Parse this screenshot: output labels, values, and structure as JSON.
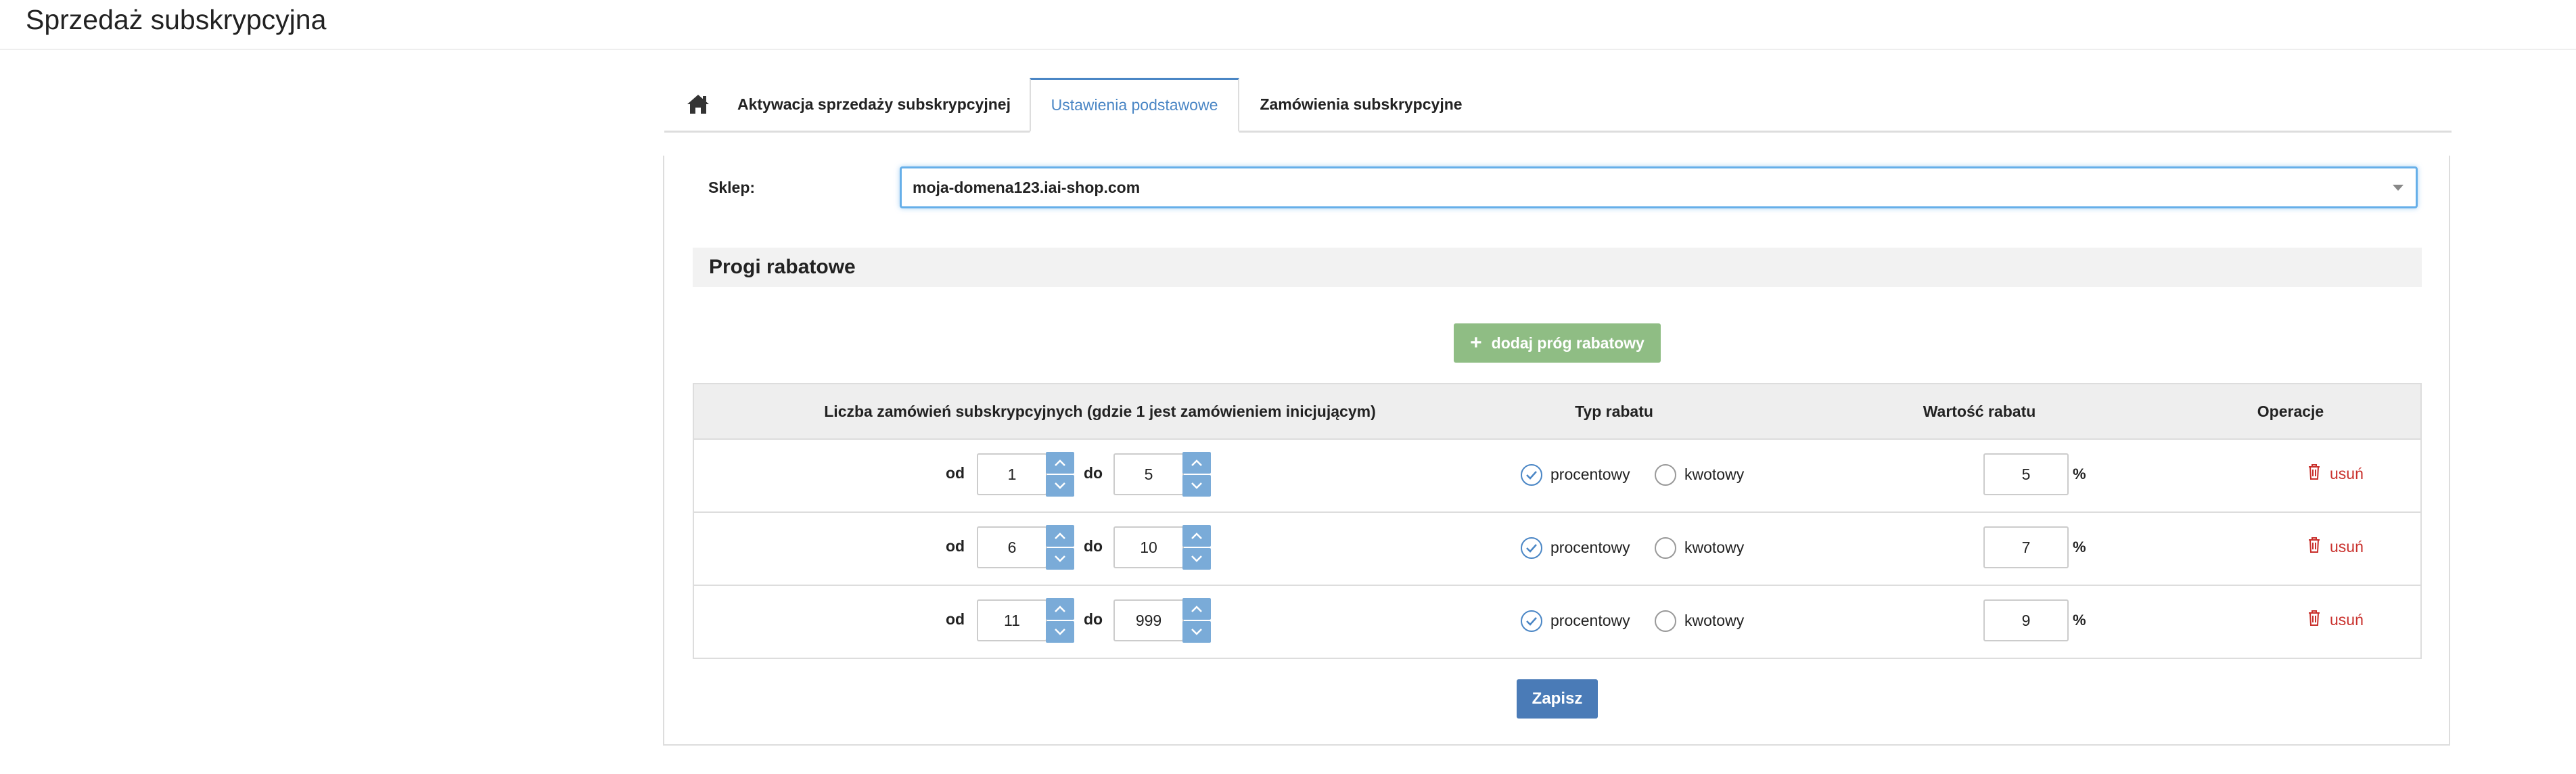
{
  "page": {
    "title": "Sprzedaż subskrypcyjna"
  },
  "tabs": {
    "home_icon": "home-icon",
    "items": [
      {
        "label": "Aktywacja sprzedaży subskrypcyjnej",
        "active": false
      },
      {
        "label": "Ustawienia podstawowe",
        "active": true
      },
      {
        "label": "Zamówienia subskrypcyjne",
        "active": false
      }
    ]
  },
  "shop": {
    "label": "Sklep:",
    "value": "moja-domena123.iai-shop.com"
  },
  "section": {
    "title": "Progi rabatowe"
  },
  "add_button": {
    "label": "dodaj próg rabatowy",
    "icon": "plus-icon"
  },
  "table": {
    "headers": [
      "Liczba zamówień subskrypcyjnych (gdzie 1 jest zamówieniem inicjującym)",
      "Typ rabatu",
      "Wartość rabatu",
      "Operacje"
    ],
    "from_label": "od",
    "to_label": "do",
    "type_percent": "procentowy",
    "type_amount": "kwotowy",
    "unit": "%",
    "delete_label": "usuń",
    "rows": [
      {
        "from": "1",
        "to": "5",
        "type": "procentowy",
        "value": "5"
      },
      {
        "from": "6",
        "to": "10",
        "type": "procentowy",
        "value": "7"
      },
      {
        "from": "11",
        "to": "999",
        "type": "procentowy",
        "value": "9"
      }
    ]
  },
  "save_button": {
    "label": "Zapisz"
  },
  "colors": {
    "accent": "#4a86c5",
    "add_button": "#8fbd84",
    "save_button": "#4a7bb7",
    "delete": "#c9302c",
    "spinner": "#7aabd8"
  }
}
